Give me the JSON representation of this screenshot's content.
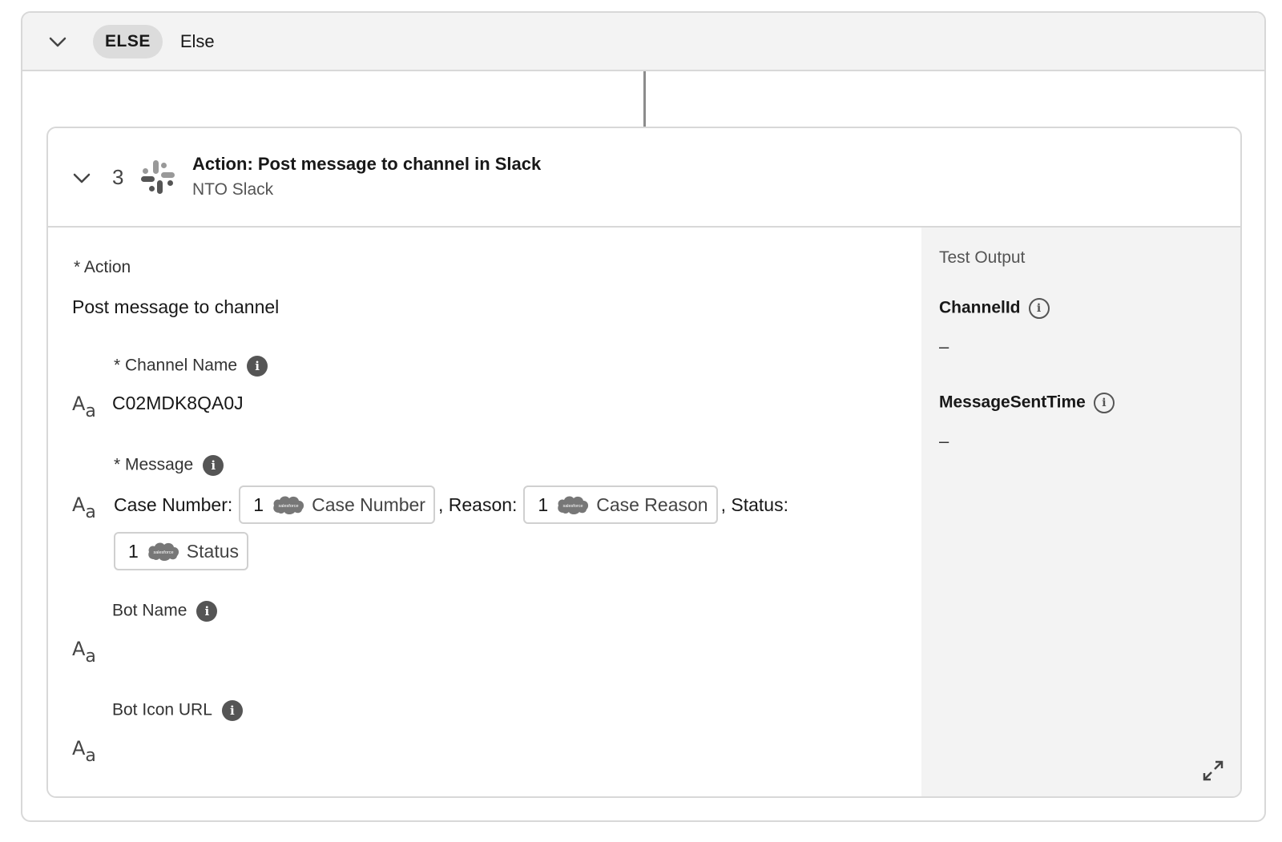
{
  "else_section": {
    "badge": "ELSE",
    "label": "Else"
  },
  "step": {
    "number": "3",
    "title": "Action: Post message to channel in Slack",
    "subtitle": "NTO Slack"
  },
  "form": {
    "action": {
      "label": "* Action",
      "value": "Post message to channel"
    },
    "channel_name": {
      "label": "* Channel Name",
      "value": "C02MDK8QA0J"
    },
    "message": {
      "label": "* Message",
      "segments": [
        {
          "text": "Case Number:"
        },
        {
          "pill_num": "1",
          "pill_label": "Case Number"
        },
        {
          "text": ", Reason:"
        },
        {
          "pill_num": "1",
          "pill_label": "Case Reason"
        },
        {
          "text": ", Status:"
        }
      ],
      "second_line_pill": {
        "pill_num": "1",
        "pill_label": "Status"
      }
    },
    "bot_name": {
      "label": "Bot Name"
    },
    "bot_icon_url": {
      "label": "Bot Icon URL"
    }
  },
  "test_output": {
    "title": "Test Output",
    "fields": [
      {
        "label": "ChannelId",
        "value": "–"
      },
      {
        "label": "MessageSentTime",
        "value": "–"
      }
    ]
  },
  "icons": {
    "chevron": "chevron-down-icon",
    "slack": "slack-logo-icon",
    "info": "info-icon",
    "text_type": "text-type-icon",
    "salesforce": "salesforce-cloud-icon",
    "expand": "expand-icon"
  },
  "colors": {
    "pane_bg": "#f3f3f3",
    "border": "#d8d8d8",
    "badge_bg": "#dcdcdc"
  }
}
